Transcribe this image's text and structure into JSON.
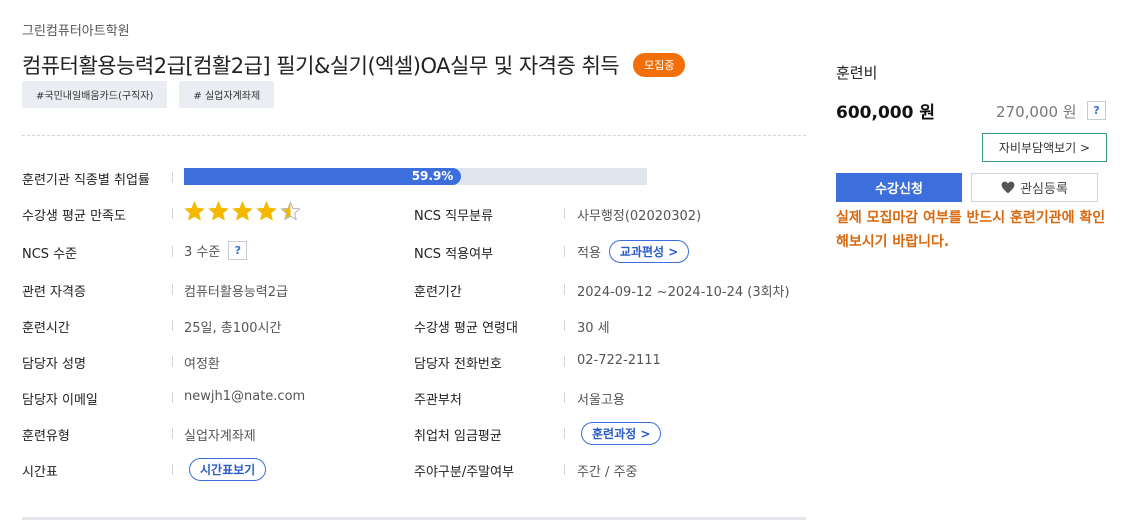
{
  "institution": "그린컴퓨터아트학원",
  "course_title": "컴퓨터활용능력2급[컴활2급] 필기&실기(엑셀)OA실무 및 자격증 취득",
  "status_badge": "모집중",
  "tags": [
    "#국민내일배움카드(구직자)",
    "# 실업자계좌제"
  ],
  "employment_rate": {
    "label": "훈련기관 직종별 취업률",
    "value": 59.9,
    "text": "59.9%"
  },
  "satisfaction": {
    "label": "수강생 평균 만족도",
    "stars": 4.5,
    "max": 5
  },
  "left_info": {
    "ncs_level": {
      "label": "NCS 수준",
      "value": "3 수준",
      "help": "?"
    },
    "certificate": {
      "label": "관련 자격증",
      "value": "컴퓨터활용능력2급"
    },
    "training_time": {
      "label": "훈련시간",
      "value": "25일, 총100시간"
    },
    "manager_name": {
      "label": "담당자 성명",
      "value": "여정환"
    },
    "manager_email": {
      "label": "담당자 이메일",
      "value": "newjh1@nate.com"
    },
    "training_type": {
      "label": "훈련유형",
      "value": "실업자계좌제"
    },
    "timetable": {
      "label": "시간표",
      "button": "시간표보기"
    }
  },
  "right_info": {
    "ncs_class": {
      "label": "NCS 직무분류",
      "value": "사무행정(02020302)"
    },
    "ncs_apply": {
      "label": "NCS 적용여부",
      "value": "적용",
      "button": "교과편성 >"
    },
    "period": {
      "label": "훈련기간",
      "value": "2024-09-12 ~2024-10-24 (3회차)"
    },
    "age": {
      "label": "수강생 평균 연령대",
      "value": "30 세"
    },
    "phone": {
      "label": "담당자 전화번호",
      "value": "02-722-2111"
    },
    "ministry": {
      "label": "주관부처",
      "value": "서울고용"
    },
    "wage": {
      "label": "취업처 임금평균",
      "button": "훈련과정 >"
    },
    "schedule": {
      "label": "주야구분/주말여부",
      "value": "주간 / 주중"
    }
  },
  "fee": {
    "label": "훈련비",
    "amount": "600,000 원",
    "self_pay": "270,000 원",
    "help": "?",
    "support_button": "자비부담액보기 >",
    "apply_button": "수강신청",
    "favorite_button": "관심등록",
    "notice": "실제 모집마감 여부를 반드시 훈련기관에 확인해보시기 바랍니다."
  },
  "colors": {
    "accent": "#3d6fdc",
    "badge": "#f26f0a",
    "star": "#f5b800",
    "notice": "#d9680e",
    "support_border": "#3a9b7d"
  }
}
